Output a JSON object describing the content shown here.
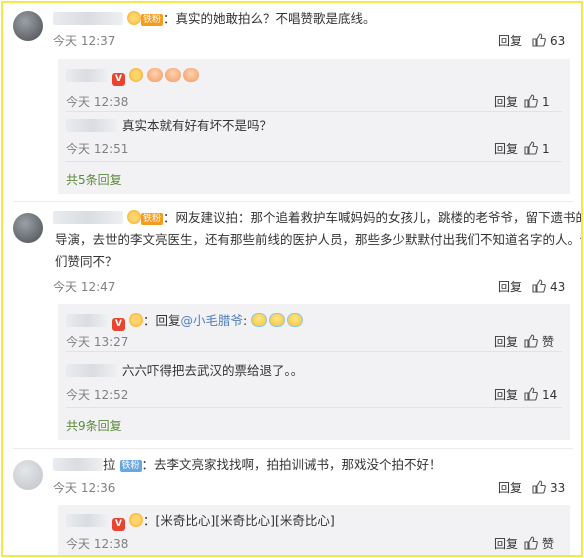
{
  "comments": [
    {
      "badge": "铁粉",
      "text": "：真实的她敢拍么？不唱赞歌是底线。",
      "time": "今天 12:37",
      "reply_label": "回复",
      "likes": "63",
      "replies": [
        {
          "text": "",
          "time": "今天 12:38",
          "reply_label": "回复",
          "likes": "1",
          "emoji_count": 3
        },
        {
          "text": "真实本就有好有坏不是吗？",
          "time": "今天 12:51",
          "reply_label": "回复",
          "likes": "1"
        }
      ],
      "more": "共5条回复"
    },
    {
      "badge": "铁粉",
      "text_line1": "：网友建议拍：那个追着救护车喊妈妈的女孩儿，跳楼的老爷爷，留下遗书的",
      "text_line2": "导演，去世的李文亮医生，还有那些前线的医护人员，那些多少默默付出我们不知道名字的人。你",
      "text_line3": "们赞同不？",
      "time": "今天 12:47",
      "reply_label": "回复",
      "likes": "43",
      "replies": [
        {
          "prefix": "：回复",
          "mention": "@小毛腊爷",
          "suffix": ":",
          "time": "今天 13:27",
          "reply_label": "回复",
          "likes": "赞"
        },
        {
          "text": "六六吓得把去武汉的票给退了。。",
          "time": "今天 12:52",
          "reply_label": "回复",
          "likes": "14"
        }
      ],
      "more": "共9条回复"
    },
    {
      "name_tail": "拉",
      "badge": "铁粉",
      "text": "：去李文亮家找找啊，拍拍训诫书，那戏没个拍不好！",
      "time": "今天 12:36",
      "reply_label": "回复",
      "likes": "33",
      "replies": [
        {
          "text": "：[米奇比心][米奇比心][米奇比心]",
          "time": "今天 12:38",
          "reply_label": "回复",
          "likes": "赞"
        }
      ]
    }
  ],
  "colors": {
    "frame": "#f4e84a",
    "link": "#4f7fbd",
    "more": "#5a8a3a",
    "badge": "#f39c1f"
  }
}
